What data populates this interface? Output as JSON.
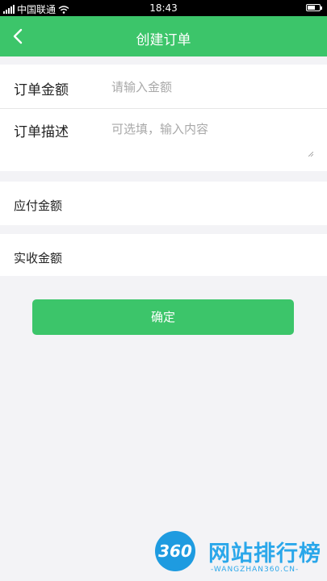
{
  "status_bar": {
    "carrier": "中国联通",
    "time": "18:43",
    "battery_level": 0.65
  },
  "app_bar": {
    "title": "创建订单",
    "back_icon": "chevron-left-icon"
  },
  "form": {
    "amount": {
      "label": "订单金额",
      "value": "",
      "placeholder": "请输入金额"
    },
    "description": {
      "label": "订单描述",
      "value": "",
      "placeholder": "可选填，输入内容"
    }
  },
  "payable": {
    "label": "应付金额"
  },
  "received": {
    "label": "实收金额"
  },
  "confirm_button": {
    "label": "确定"
  },
  "watermark": {
    "logo_text": "360",
    "text": "网站排行榜",
    "subtext": "-WANGZHAN360.CN-"
  },
  "colors": {
    "accent": "#3cc56a",
    "background": "#f3f3f6",
    "watermark": "#2aa7ea"
  }
}
